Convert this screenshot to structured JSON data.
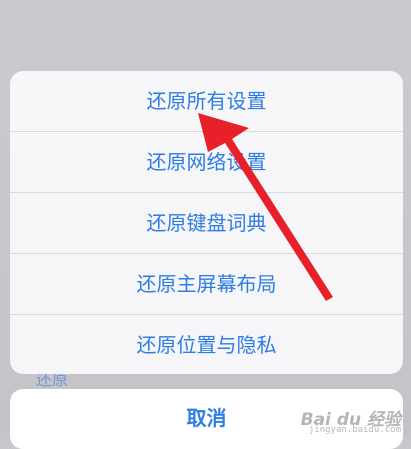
{
  "actions": [
    {
      "label": "还原所有设置"
    },
    {
      "label": "还原网络设置"
    },
    {
      "label": "还原键盘词典"
    },
    {
      "label": "还原主屏幕布局"
    },
    {
      "label": "还原位置与隐私"
    }
  ],
  "background_hint": "还原",
  "cancel_label": "取消",
  "watermark": {
    "brand": "Bai du 经验",
    "sub": "jingyan.baidu.com"
  },
  "colors": {
    "accent": "#2f7de1",
    "arrow": "#e8202a",
    "backdrop": "#c7c7cc"
  }
}
